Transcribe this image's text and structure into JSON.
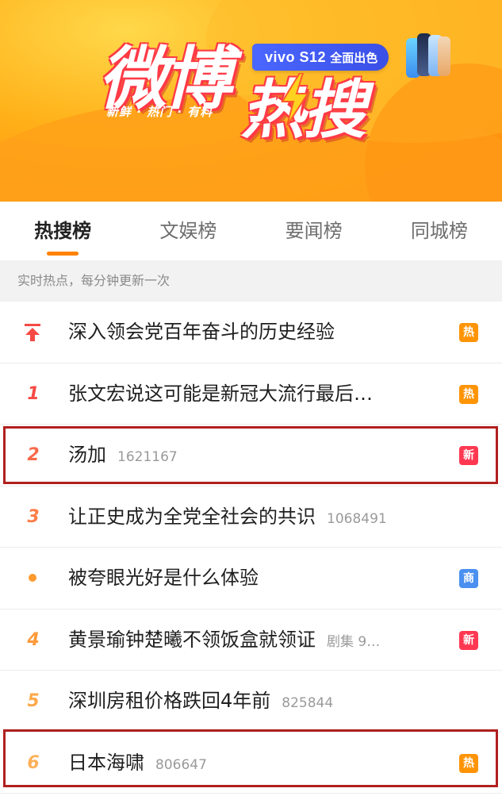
{
  "banner": {
    "logo_weibo": "微博",
    "logo_hot": "热搜",
    "slogan": "新鲜 · 热门 · 有料",
    "ad_brand": "vivo S12",
    "ad_tagline": "全面出色"
  },
  "tabs": [
    {
      "label": "热搜榜",
      "active": true
    },
    {
      "label": "文娱榜",
      "active": false
    },
    {
      "label": "要闻榜",
      "active": false
    },
    {
      "label": "同城榜",
      "active": false
    }
  ],
  "subheader": "实时热点，每分钟更新一次",
  "colors": {
    "accent": "#ff8200",
    "rank_top": "#f54a45",
    "rank_mid": "#ff8b3d",
    "rank_low": "#ffb05a",
    "badge_hot": "#ff9406",
    "badge_new": "#ff3852",
    "badge_ad": "#4a90f0",
    "highlight": "#b0201e"
  },
  "items": [
    {
      "rank": "",
      "rank_icon": "pin-up-icon",
      "title": "深入领会党百年奋斗的历史经验",
      "count": "",
      "badge": "热",
      "badge_type": "hot"
    },
    {
      "rank": "1",
      "title": "张文宏说这可能是新冠大流行最后…",
      "count": "",
      "badge": "热",
      "badge_type": "hot"
    },
    {
      "rank": "2",
      "title": "汤加",
      "count": "1621167",
      "badge": "新",
      "badge_type": "new",
      "highlighted": true
    },
    {
      "rank": "3",
      "title": "让正史成为全党全社会的共识",
      "count": "1068491",
      "badge": "",
      "badge_type": ""
    },
    {
      "rank": "",
      "rank_icon": "dot-icon",
      "title": "被夸眼光好是什么体验",
      "count": "",
      "badge": "商",
      "badge_type": "ad"
    },
    {
      "rank": "4",
      "title": "黄景瑜钟楚曦不领饭盒就领证",
      "count": "剧集 9…",
      "badge": "新",
      "badge_type": "new"
    },
    {
      "rank": "5",
      "title": "深圳房租价格跌回4年前",
      "count": "825844",
      "badge": "",
      "badge_type": ""
    },
    {
      "rank": "6",
      "title": "日本海啸",
      "count": "806647",
      "badge": "热",
      "badge_type": "hot",
      "highlighted": true
    }
  ]
}
